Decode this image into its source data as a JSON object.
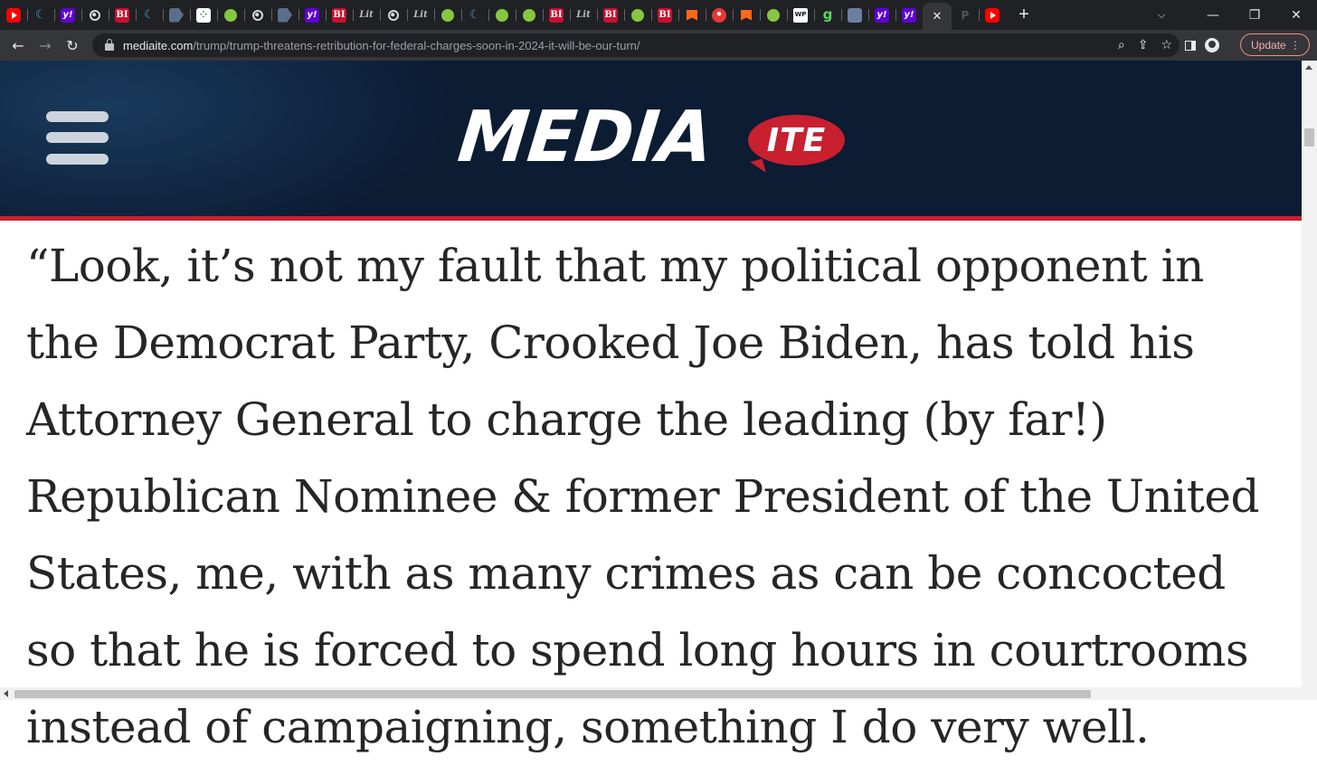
{
  "browser": {
    "tabs": [
      {
        "icon": "youtube-icon",
        "class": "yt",
        "glyph": ""
      },
      {
        "icon": "shield-icon",
        "class": "shield",
        "glyph": "☾"
      },
      {
        "icon": "yahoo-icon",
        "class": "yahoo",
        "glyph": "y!"
      },
      {
        "icon": "globe-icon",
        "class": "globe",
        "glyph": ""
      },
      {
        "icon": "business-insider-icon",
        "class": "bi",
        "glyph": "BI"
      },
      {
        "icon": "shield-icon",
        "class": "shield",
        "glyph": "☾"
      },
      {
        "icon": "document-icon",
        "class": "doc",
        "glyph": ""
      },
      {
        "icon": "grid-icon",
        "class": "dots",
        "glyph": "⁘"
      },
      {
        "icon": "rumble-icon",
        "class": "rumble",
        "glyph": ""
      },
      {
        "icon": "globe-icon",
        "class": "globe",
        "glyph": ""
      },
      {
        "icon": "document-icon",
        "class": "doc",
        "glyph": ""
      },
      {
        "icon": "yahoo-icon",
        "class": "yahoo",
        "glyph": "y!"
      },
      {
        "icon": "business-insider-icon",
        "class": "bi",
        "glyph": "BI"
      },
      {
        "icon": "lit-icon",
        "class": "lit",
        "glyph": "Lit"
      },
      {
        "icon": "globe-icon",
        "class": "globe",
        "glyph": ""
      },
      {
        "icon": "lit-icon",
        "class": "lit",
        "glyph": "Lit"
      },
      {
        "icon": "rumble-icon",
        "class": "rumble",
        "glyph": ""
      },
      {
        "icon": "shield-icon",
        "class": "shield",
        "glyph": "☾"
      },
      {
        "icon": "rumble-icon",
        "class": "rumble",
        "glyph": ""
      },
      {
        "icon": "rumble-icon",
        "class": "rumble",
        "glyph": ""
      },
      {
        "icon": "business-insider-icon",
        "class": "bi",
        "glyph": "BI"
      },
      {
        "icon": "lit-icon",
        "class": "lit",
        "glyph": "Lit"
      },
      {
        "icon": "business-insider-icon",
        "class": "bi",
        "glyph": "BI"
      },
      {
        "icon": "rumble-icon",
        "class": "rumble",
        "glyph": ""
      },
      {
        "icon": "business-insider-icon",
        "class": "bi",
        "glyph": "BI"
      },
      {
        "icon": "substack-icon",
        "class": "substack",
        "glyph": ""
      },
      {
        "icon": "microphone-icon",
        "class": "redmic",
        "glyph": "⏺"
      },
      {
        "icon": "substack-icon",
        "class": "substack",
        "glyph": ""
      },
      {
        "icon": "rumble-icon",
        "class": "rumble",
        "glyph": ""
      },
      {
        "icon": "wp-icon",
        "class": "wp",
        "glyph": "WP"
      },
      {
        "icon": "gettr-icon",
        "class": "gett",
        "glyph": "g"
      },
      {
        "icon": "portrait-icon",
        "class": "pic",
        "glyph": ""
      },
      {
        "icon": "yahoo-icon",
        "class": "yahoo",
        "glyph": "y!"
      },
      {
        "icon": "yahoo-icon",
        "class": "yahoo",
        "glyph": "y!"
      },
      {
        "icon": "close-icon",
        "class": "close",
        "glyph": "✕",
        "active": true
      },
      {
        "icon": "p-icon",
        "class": "p",
        "glyph": "P"
      },
      {
        "icon": "youtube-icon",
        "class": "yt",
        "glyph": ""
      }
    ],
    "new_tab_glyph": "+",
    "tab_search_glyph": "⌵",
    "minimize_glyph": "—",
    "restore_glyph": "❐",
    "close_window_glyph": "✕",
    "back_glyph": "←",
    "forward_glyph": "→",
    "reload_glyph": "↻",
    "url_host": "mediaite.com",
    "url_path": "/trump/trump-threatens-retribution-for-federal-charges-soon-in-2024-it-will-be-our-turn/",
    "zoom_glyph": "⌕",
    "share_glyph": "⇪",
    "bookmark_glyph": "☆",
    "update_label": "Update",
    "menu_glyph": "⋮"
  },
  "site": {
    "logo_main": "MEDIA",
    "logo_bubble": "ITE",
    "brand_colors": {
      "navy": "#0b1c33",
      "red": "#c8202f"
    }
  },
  "article": {
    "quote_text": "“Look, it’s not my fault that my political opponent in the Democrat Party, Crooked Joe Biden, has told his Attorney General to charge the leading (by far!) Republican Nominee & former President of the United States, me, with as many crimes as can be concocted so that he is forced to spend long hours in courtrooms instead of campaigning, something I do very well."
  }
}
